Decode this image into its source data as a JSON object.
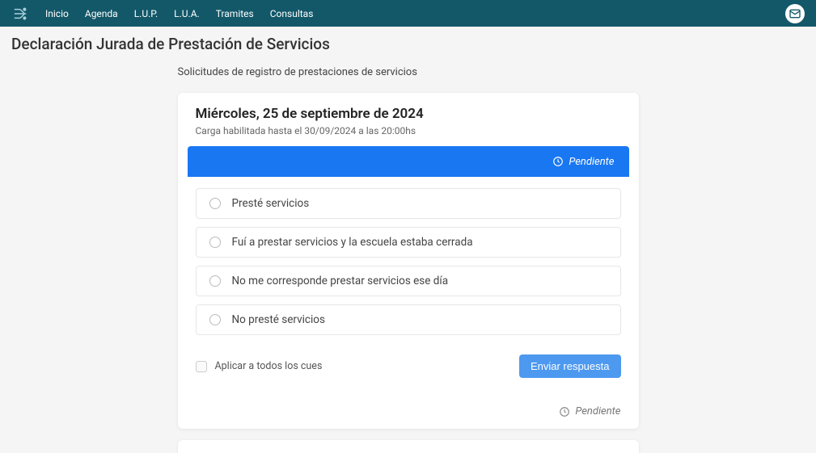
{
  "nav": {
    "items": [
      "Inicio",
      "Agenda",
      "L.U.P.",
      "L.U.A.",
      "Tramites",
      "Consultas"
    ]
  },
  "page": {
    "title": "Declaración Jurada de Prestación de Servicios",
    "subtitle": "Solicitudes de registro de prestaciones de servicios"
  },
  "card": {
    "date": "Miércoles, 25 de septiembre de 2024",
    "deadline": "Carga habilitada hasta el 30/09/2024 a las 20:00hs",
    "status": "Pendiente",
    "options": [
      "Presté servicios",
      "Fuí a prestar servicios y la escuela estaba cerrada",
      "No me corresponde prestar servicios ese día",
      "No presté servicios"
    ],
    "apply_all": "Aplicar a todos los cues",
    "send": "Enviar respuesta",
    "footer_status": "Pendiente"
  }
}
